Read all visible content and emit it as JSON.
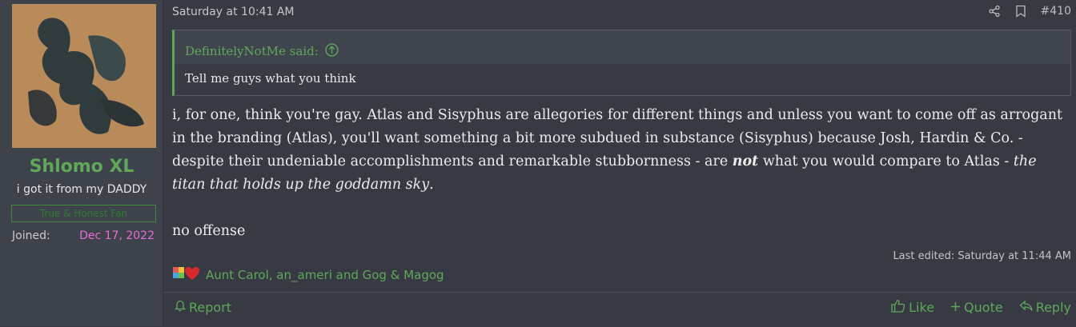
{
  "user": {
    "name": "Shlomo XL",
    "title": "i got it from my DADDY",
    "banner": "True & Honest Fan",
    "joined_label": "Joined:",
    "joined_date": "Dec 17, 2022"
  },
  "post": {
    "date": "Saturday at 10:41 AM",
    "number": "#410",
    "quote": {
      "author": "DefinitelyNotMe said:",
      "text": "Tell me guys what you think"
    },
    "body": {
      "p1_a": "i, for one, think you're gay. Atlas and Sisyphus are allegories for different things and unless you want to come off as arrogant in the branding (Atlas), you'll want something a bit more subdued in substance (Sisyphus) because Josh, Hardin & Co. - despite their undeniable accomplishments and remarkable stubbornness - are ",
      "p1_strong": "not",
      "p1_b": " what you would compare to Atlas - ",
      "p1_em": "the titan that holds up the goddamn sky",
      "p1_c": ".",
      "p2": "no offense"
    },
    "last_edited": "Last edited: Saturday at 11:44 AM",
    "reaction_users": "Aunt Carol, an_ameri and Gog & Magog"
  },
  "footer": {
    "report": "Report",
    "like": "Like",
    "quote": "Quote",
    "reply": "Reply"
  },
  "colors": {
    "accent": "#5fa85a",
    "joined_date": "#e86bd6",
    "background": "#373a43"
  },
  "icons": [
    "share-icon",
    "bookmark-icon",
    "arrow-up-circle-icon",
    "puzzle-reaction-icon",
    "heart-reaction-icon",
    "bell-icon",
    "thumbs-up-icon",
    "plus-icon",
    "reply-arrow-icon"
  ]
}
